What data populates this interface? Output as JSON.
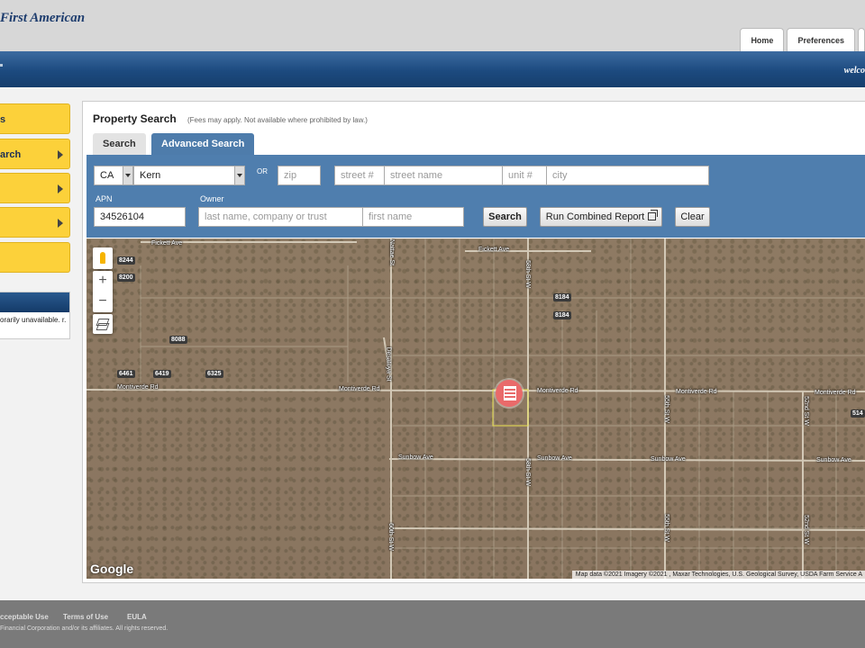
{
  "header": {
    "logo_text": "First American",
    "top_tabs": [
      "Home",
      "Preferences",
      ""
    ],
    "welcome_text": "welco"
  },
  "sidebar": {
    "items": [
      {
        "label": "s",
        "has_arrow": false
      },
      {
        "label": "arch",
        "has_arrow": true
      },
      {
        "label": "",
        "has_arrow": true
      },
      {
        "label": "",
        "has_arrow": true
      },
      {
        "label": "",
        "has_arrow": false
      }
    ],
    "notice_text": "orarily unavailable. r."
  },
  "panel": {
    "title": "Property Search",
    "fees_note": "(Fees may apply. Not available where prohibited by law.)",
    "tabs": [
      "Search",
      "Advanced Search"
    ],
    "active_tab": "Advanced Search"
  },
  "form": {
    "state_value": "CA",
    "county_value": "Kern",
    "or_label": "OR",
    "zip_placeholder": "zip",
    "street_num_placeholder": "street #",
    "street_name_placeholder": "street name",
    "unit_placeholder": "unit #",
    "city_placeholder": "city",
    "apn_label": "APN",
    "apn_value": "34526104",
    "owner_label": "Owner",
    "owner_last_placeholder": "last name, company or trust",
    "owner_first_placeholder": "first name",
    "search_button": "Search",
    "combined_button": "Run Combined Report",
    "clear_button": "Clear"
  },
  "map": {
    "streets": [
      "Fickett Ave",
      "Fickett Ave",
      "Montiverde Rd",
      "Montiverde Rd",
      "Montiverde Rd",
      "Montiverde Rd",
      "Montiverde Rd",
      "Sunbow Ave",
      "Sunbow Ave",
      "Sunbow Ave",
      "Sunbow Ave",
      "Desatoya St",
      "58th St W",
      "58th St W",
      "60th St W",
      "55th St W",
      "55th St W",
      "52nd St W",
      "52nd St W",
      "Nattae St"
    ],
    "house_numbers": [
      "8244",
      "8200",
      "8184",
      "8184",
      "8088",
      "6461",
      "6419",
      "6325",
      "514"
    ],
    "logo": "Google",
    "attribution": "Map data ©2021 Imagery ©2021 , Maxar Technologies, U.S. Geological Survey, USDA Farm Service A"
  },
  "footer": {
    "links": [
      "cceptable Use",
      "Terms of Use",
      "EULA"
    ],
    "copyright": "Financial Corporation and/or its affiliates. All rights reserved."
  },
  "colors": {
    "brand_blue": "#1c4a7f",
    "nav_yellow": "#fcd13a",
    "form_blue": "#4f7eae"
  }
}
